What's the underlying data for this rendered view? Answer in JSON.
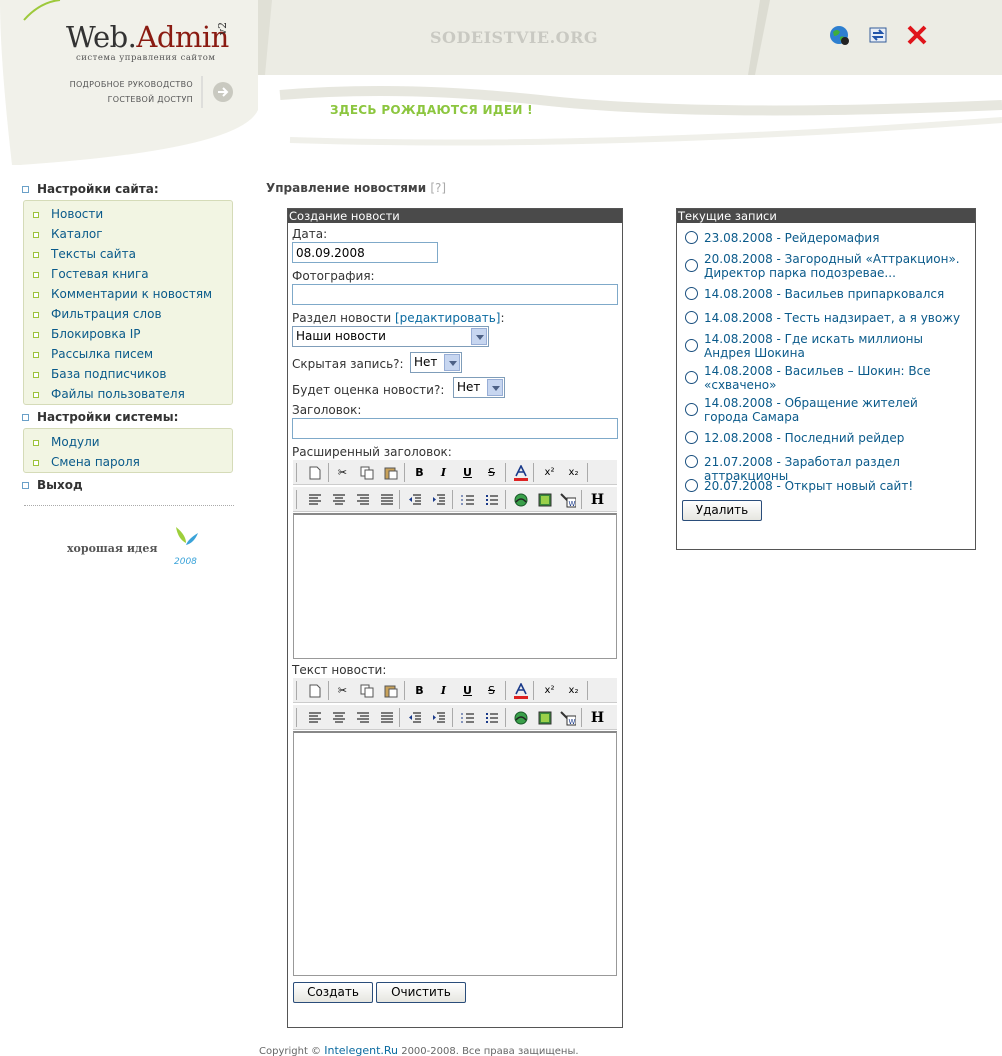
{
  "header": {
    "logo_text": "Web.",
    "logo_text_accent": "Admin",
    "logo_version": "v2",
    "logo_subtitle": "система управления сайтом",
    "link_manual": "ПОДРОБНОЕ РУКОВОДСТВО",
    "link_guest": "ГОСТЕВОЙ ДОСТУП",
    "site_name": "SODEISTVIE.ORG",
    "slogan": "ЗДЕСЬ РОЖДАЮТСЯ ИДЕИ !"
  },
  "sidebar": {
    "site_settings_title": "Настройки сайта:",
    "site_settings_items": [
      "Новости",
      "Каталог",
      "Тексты сайта",
      "Гостевая книга",
      "Комментарии к новостям",
      "Фильтрация слов",
      "Блокировка IP",
      "Рассылка писем",
      "База подписчиков",
      "Файлы пользователя"
    ],
    "system_settings_title": "Настройки системы:",
    "system_settings_items": [
      "Модули",
      "Смена пароля"
    ],
    "exit_label": "Выход",
    "badge_text": "хорошая идея",
    "badge_year": "2008"
  },
  "main": {
    "page_title": "Управление новостями",
    "help_mark": "[?]",
    "create_box": {
      "title": "Создание новости",
      "date_label": "Дата:",
      "date_value": "08.09.2008",
      "photo_label": "Фотография:",
      "photo_value": "",
      "section_label": "Раздел новости",
      "section_edit_link": "[редактировать]",
      "section_colon": ":",
      "section_value": "Наши новости",
      "hidden_label": "Скрытая запись?:",
      "hidden_value": "Нет",
      "rating_label": "Будет оценка новости?:",
      "rating_value": "Нет",
      "heading_label": "Заголовок:",
      "heading_value": "",
      "ext_heading_label": "Расширенный заголовок:",
      "news_text_label": "Текст новости:",
      "create_button": "Создать",
      "clear_button": "Очистить"
    },
    "records_box": {
      "title": "Текущие записи",
      "items": [
        "23.08.2008 - Рейдеромафия",
        "20.08.2008 - Загородный «Аттракцион». Директор парка подозревае...",
        "14.08.2008 - Васильев припарковался",
        "14.08.2008 - Тесть надзирает, а я увожу",
        "14.08.2008 - Где искать миллионы Андрея Шокина",
        "14.08.2008 - Васильев – Шокин: Все «схвачено»",
        "14.08.2008 - Обращение жителей города Самара",
        "12.08.2008 - Последний рейдер",
        "21.07.2008 - Заработал раздел аттракционы",
        "20.07.2008 - Открыт новый сайт!"
      ],
      "delete_button": "Удалить"
    }
  },
  "toolbar_icons": {
    "bold": "B",
    "italic": "I",
    "underline": "U",
    "strike": "S",
    "superscript": "x²",
    "subscript": "x₂",
    "heading": "H"
  },
  "footer": {
    "prefix": "Copyright ©",
    "link": "Intelegent.Ru",
    "suffix": "2000-2008. Все права защищены."
  },
  "colors": {
    "accent_link": "#0a5a8a",
    "slogan_green": "#8cc63f",
    "logo_red": "#8a1b12",
    "box_header": "#4a4a4a",
    "menu_bg": "#f2f5e3"
  }
}
